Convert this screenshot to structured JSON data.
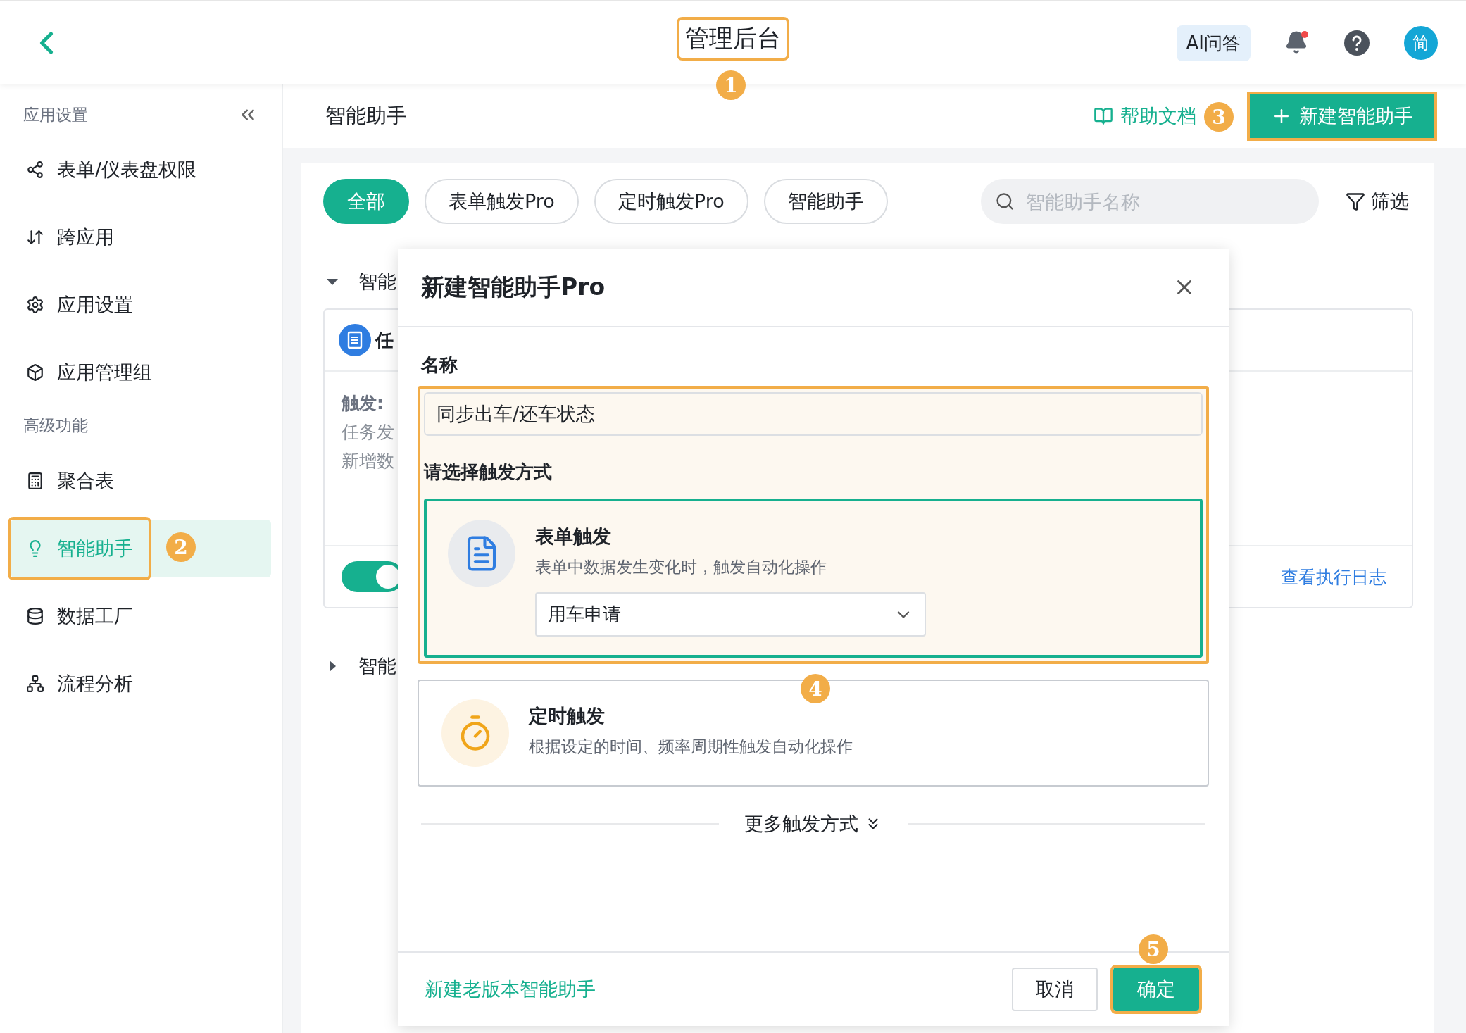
{
  "topbar": {
    "title": {
      "text": "管理后台",
      "highlighted": true
    },
    "ai_button": "AI问答",
    "avatar": "简"
  },
  "sidebar": {
    "sections": [
      {
        "label": "应用设置",
        "items": [
          {
            "label": "表单/仪表盘权限",
            "selected": false,
            "highlighted": false
          },
          {
            "label": "跨应用",
            "selected": false,
            "highlighted": false
          },
          {
            "label": "应用设置",
            "selected": false,
            "highlighted": false
          },
          {
            "label": "应用管理组",
            "selected": false,
            "highlighted": false
          }
        ]
      },
      {
        "label": "高级功能",
        "items": [
          {
            "label": "聚合表",
            "selected": false,
            "highlighted": false
          },
          {
            "label": "智能助手",
            "selected": true,
            "highlighted": true
          },
          {
            "label": "数据工厂",
            "selected": false,
            "highlighted": false
          },
          {
            "label": "流程分析",
            "selected": false,
            "highlighted": false
          }
        ]
      }
    ]
  },
  "page_header": {
    "title": "智能助手",
    "help_link": "帮助文档",
    "create_button": {
      "label": "新建智能助手",
      "highlighted": true
    }
  },
  "filters": {
    "chips": [
      {
        "label": "全部",
        "selected": true
      },
      {
        "label": "表单触发Pro",
        "selected": false
      },
      {
        "label": "定时触发Pro",
        "selected": false
      },
      {
        "label": "智能助手",
        "selected": false
      }
    ],
    "search": {
      "placeholder": "智能助手名称"
    },
    "filter_button": "筛选"
  },
  "groups": [
    {
      "title": "智能",
      "expanded": true,
      "cards": [
        {
          "title": "任",
          "trigger_label": "触发:",
          "trigger_lines": [
            "任务发",
            "新增数"
          ],
          "enabled": true,
          "log_link": "查看执行日志"
        }
      ]
    },
    {
      "title": "智能",
      "expanded": false
    }
  ],
  "dialog": {
    "title": "新建智能助手Pro",
    "name_label": "名称",
    "name_value": "同步出车/还车状态",
    "trigger_label": "请选择触发方式",
    "highlighted": true,
    "triggers": [
      {
        "kind": "form",
        "title": "表单触发",
        "description": "表单中数据发生变化时，触发自动化操作",
        "selected": true,
        "select_value": "用车申请"
      },
      {
        "kind": "timer",
        "title": "定时触发",
        "description": "根据设定的时间、频率周期性触发自动化操作",
        "selected": false
      }
    ],
    "more_link": "更多触发方式",
    "legacy_link": "新建老版本智能助手",
    "cancel": "取消",
    "confirm": {
      "label": "确定",
      "highlighted": true
    }
  },
  "annotations": [
    "1",
    "2",
    "3",
    "4",
    "5"
  ]
}
